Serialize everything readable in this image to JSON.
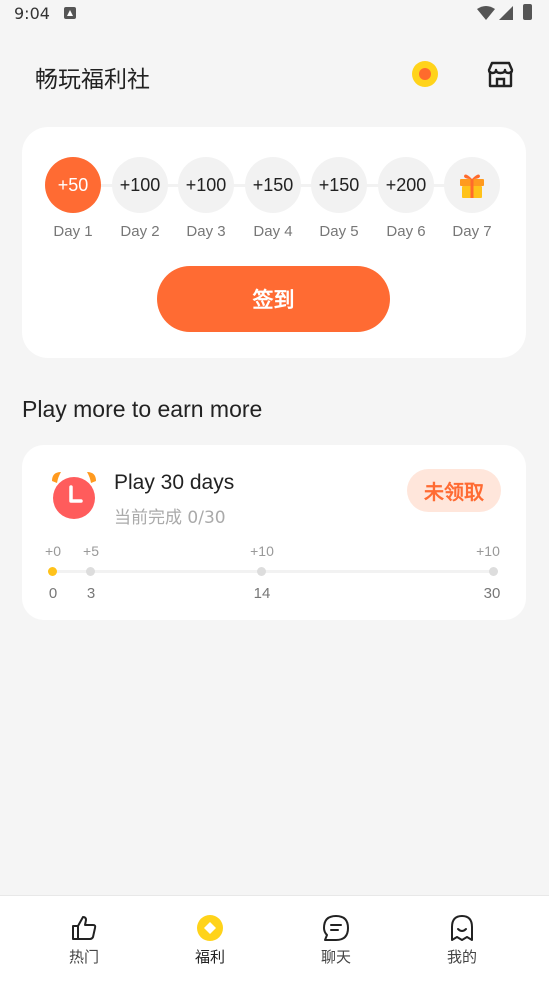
{
  "status_bar": {
    "time": "9:04"
  },
  "header": {
    "title": "畅玩福利社"
  },
  "checkin": {
    "days": [
      {
        "reward": "+50",
        "label": "Day 1",
        "active": true
      },
      {
        "reward": "+100",
        "label": "Day 2"
      },
      {
        "reward": "+100",
        "label": "Day 3"
      },
      {
        "reward": "+150",
        "label": "Day 4"
      },
      {
        "reward": "+150",
        "label": "Day 5"
      },
      {
        "reward": "+200",
        "label": "Day 6"
      },
      {
        "reward": "",
        "label": "Day 7",
        "icon": "gift-icon"
      }
    ],
    "button_label": "签到"
  },
  "section_title": "Play more to earn more",
  "task": {
    "icon": "alarm-clock-icon",
    "title": "Play 30 days",
    "progress_text": "当前完成 0/30",
    "claim_label": "未领取",
    "milestones": [
      {
        "reward": "+0",
        "day": "0",
        "done": true
      },
      {
        "reward": "+5",
        "day": "3"
      },
      {
        "reward": "+10",
        "day": "14"
      },
      {
        "reward": "+10",
        "day": "30"
      }
    ]
  },
  "bottom_nav": {
    "items": [
      {
        "label": "热门",
        "icon": "thumbs-up-icon"
      },
      {
        "label": "福利",
        "icon": "coin-icon",
        "active": true
      },
      {
        "label": "聊天",
        "icon": "chat-icon"
      },
      {
        "label": "我的",
        "icon": "ghost-profile-icon"
      }
    ]
  },
  "colors": {
    "accent": "#ff6b33",
    "coin": "#ffd31a",
    "background": "#f5f5f5"
  }
}
